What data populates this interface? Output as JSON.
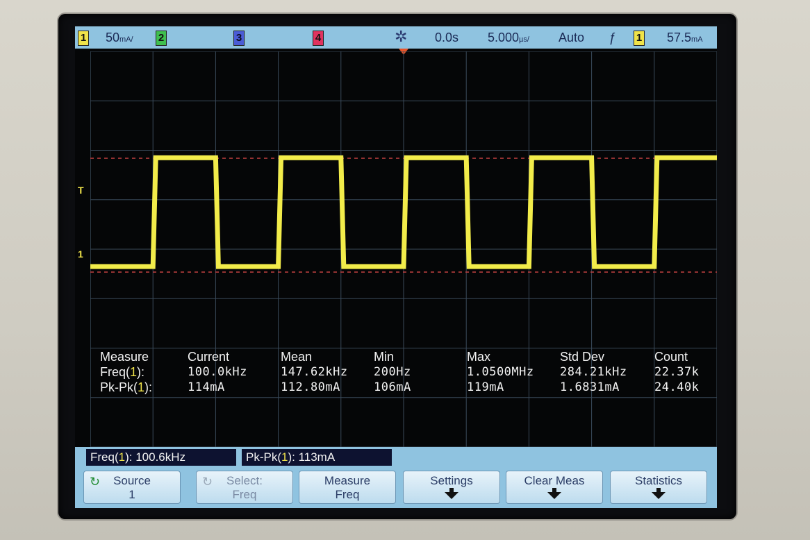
{
  "status_bar": {
    "ch1_label": "1",
    "ch1_scale": "50",
    "ch1_unit": "mA/",
    "ch2_label": "2",
    "ch3_label": "3",
    "ch4_label": "4",
    "trigger_delay": "0.0s",
    "timebase": "5.000",
    "timebase_unit": "µs/",
    "trigger_mode": "Auto",
    "trigger_slope": "ƒ",
    "trigger_source": "1",
    "trigger_level": "57.5",
    "trigger_level_unit": "mA"
  },
  "waveform": {
    "channel": "1",
    "type": "square",
    "frequency_khz": 100,
    "cycles_visible": 5,
    "color": "#f2ec4a",
    "low_level_div": 0.0,
    "high_level_div": 2.2
  },
  "markers": {
    "trigger_level_label": "T",
    "ch1_ground_label": "1"
  },
  "measurements": {
    "headers": [
      "Measure",
      "Current",
      "Mean",
      "Min",
      "Max",
      "Std Dev",
      "Count"
    ],
    "rows": [
      {
        "name": "Freq(",
        "ch": "1",
        "suffix": "):",
        "current": "100.0kHz",
        "mean": "147.62kHz",
        "min": "200Hz",
        "max": "1.0500MHz",
        "stddev": "284.21kHz",
        "count": "22.37k"
      },
      {
        "name": "Pk-Pk(",
        "ch": "1",
        "suffix": "):",
        "current": "114mA",
        "mean": "112.80mA",
        "min": "106mA",
        "max": "119mA",
        "stddev": "1.6831mA",
        "count": "24.40k"
      }
    ]
  },
  "readouts": [
    {
      "name": "Freq(",
      "ch": "1",
      "value": "): 100.6kHz"
    },
    {
      "name": "Pk-Pk(",
      "ch": "1",
      "value": "): 113mA"
    }
  ],
  "softkeys": [
    {
      "line1": "Source",
      "line2": "1",
      "icon": "rotate-icon",
      "enabled": true,
      "arrow": false
    },
    {
      "line1": "Select:",
      "line2": "Freq",
      "icon": "rotate-icon",
      "enabled": false,
      "arrow": false
    },
    {
      "line1": "Measure",
      "line2": "Freq",
      "icon": "",
      "enabled": true,
      "arrow": false
    },
    {
      "line1": "Settings",
      "line2": "",
      "icon": "",
      "enabled": true,
      "arrow": true
    },
    {
      "line1": "Clear Meas",
      "line2": "",
      "icon": "",
      "enabled": true,
      "arrow": true
    },
    {
      "line1": "Statistics",
      "line2": "",
      "icon": "",
      "enabled": true,
      "arrow": true
    }
  ],
  "colors": {
    "accent_bar": "#8fc3e0",
    "trace_ch1": "#f2ec4a",
    "ch2": "#3fbf4f",
    "ch3": "#4a5cd6",
    "ch4": "#e0335f",
    "trigger_marker": "#e8552a"
  }
}
